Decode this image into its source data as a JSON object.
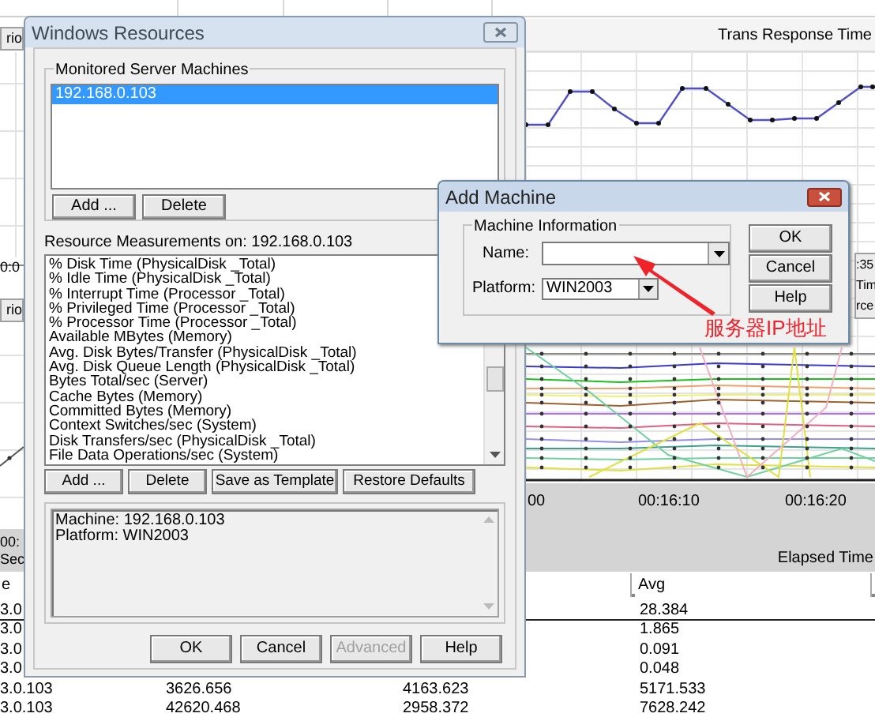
{
  "background_app": {
    "left_tabs": [
      "rio",
      "rio"
    ],
    "left_axis_labels": [
      "0:0",
      "00:",
      "Sec"
    ],
    "chart_title": "Trans Response Time",
    "legend_fragments": [
      ":35",
      "Tim",
      "rce"
    ],
    "axis_labels": [
      "00",
      "00:16:10",
      "00:16:20"
    ],
    "axis_title": "Elapsed Time",
    "table": {
      "columns": [
        "e",
        "Avg"
      ],
      "rows": [
        {
          "column_1": "3.0",
          "avg": "28.384"
        },
        {
          "column_1": "3.0",
          "avg": "1.865"
        },
        {
          "column_1": "3.0",
          "avg": "0.091"
        },
        {
          "column_1": "3.0",
          "avg": "0.048"
        },
        {
          "column_1": "3.0.103",
          "column_2": "3626.656",
          "column_3": "4163.623",
          "avg": "5171.533"
        },
        {
          "column_1": "3.0.103",
          "column_2": "42620.468",
          "column_3": "2958.372",
          "avg": "7628.242"
        }
      ]
    }
  },
  "windows_resources": {
    "title": "Windows Resources",
    "monitored_group": {
      "label": "Monitored Server Machines",
      "machines": [
        {
          "label": "192.168.0.103",
          "selected": true
        }
      ],
      "buttons": [
        "Add ...",
        "Delete"
      ]
    },
    "measurements_label": "Resource Measurements on: 192.168.0.103",
    "measurements": [
      {
        "label": "% Disk Time (PhysicalDisk _Total)",
        "selected": false
      },
      {
        "label": "% Idle Time (PhysicalDisk _Total)",
        "selected": false
      },
      {
        "label": "% Interrupt Time (Processor _Total)",
        "selected": false
      },
      {
        "label": "% Privileged Time (Processor _Total)",
        "selected": false
      },
      {
        "label": "% Processor Time (Processor _Total)",
        "selected": false
      },
      {
        "label": "Available MBytes (Memory)",
        "selected": false
      },
      {
        "label": "Avg. Disk Bytes/Transfer (PhysicalDisk _Total)",
        "selected": false
      },
      {
        "label": "Avg. Disk Queue Length (PhysicalDisk _Total)",
        "selected": false
      },
      {
        "label": "Bytes Total/sec (Server)",
        "selected": false
      },
      {
        "label": "Cache Bytes (Memory)",
        "selected": false
      },
      {
        "label": "Committed Bytes (Memory)",
        "selected": false
      },
      {
        "label": "Context Switches/sec (System)",
        "selected": false
      },
      {
        "label": "Disk Transfers/sec (PhysicalDisk _Total)",
        "selected": false
      },
      {
        "label": "File Data Operations/sec (System)",
        "selected": false
      }
    ],
    "measurement_buttons": [
      "Add ...",
      "Delete",
      "Save as Template",
      "Restore Defaults"
    ],
    "info_lines": [
      "Machine: 192.168.0.103",
      "Platform: WIN2003"
    ],
    "buttons": [
      {
        "label": "OK",
        "disabled": false
      },
      {
        "label": "Cancel",
        "disabled": false
      },
      {
        "label": "Advanced",
        "disabled": true
      },
      {
        "label": "Help",
        "disabled": false
      }
    ]
  },
  "add_machine": {
    "title": "Add Machine",
    "group_label": "Machine Information",
    "name_label": "Name:",
    "platform_label": "Platform:",
    "platform_value": "WIN2003",
    "buttons": [
      "OK",
      "Cancel",
      "Help"
    ],
    "annotation": "服务器IP地址"
  }
}
